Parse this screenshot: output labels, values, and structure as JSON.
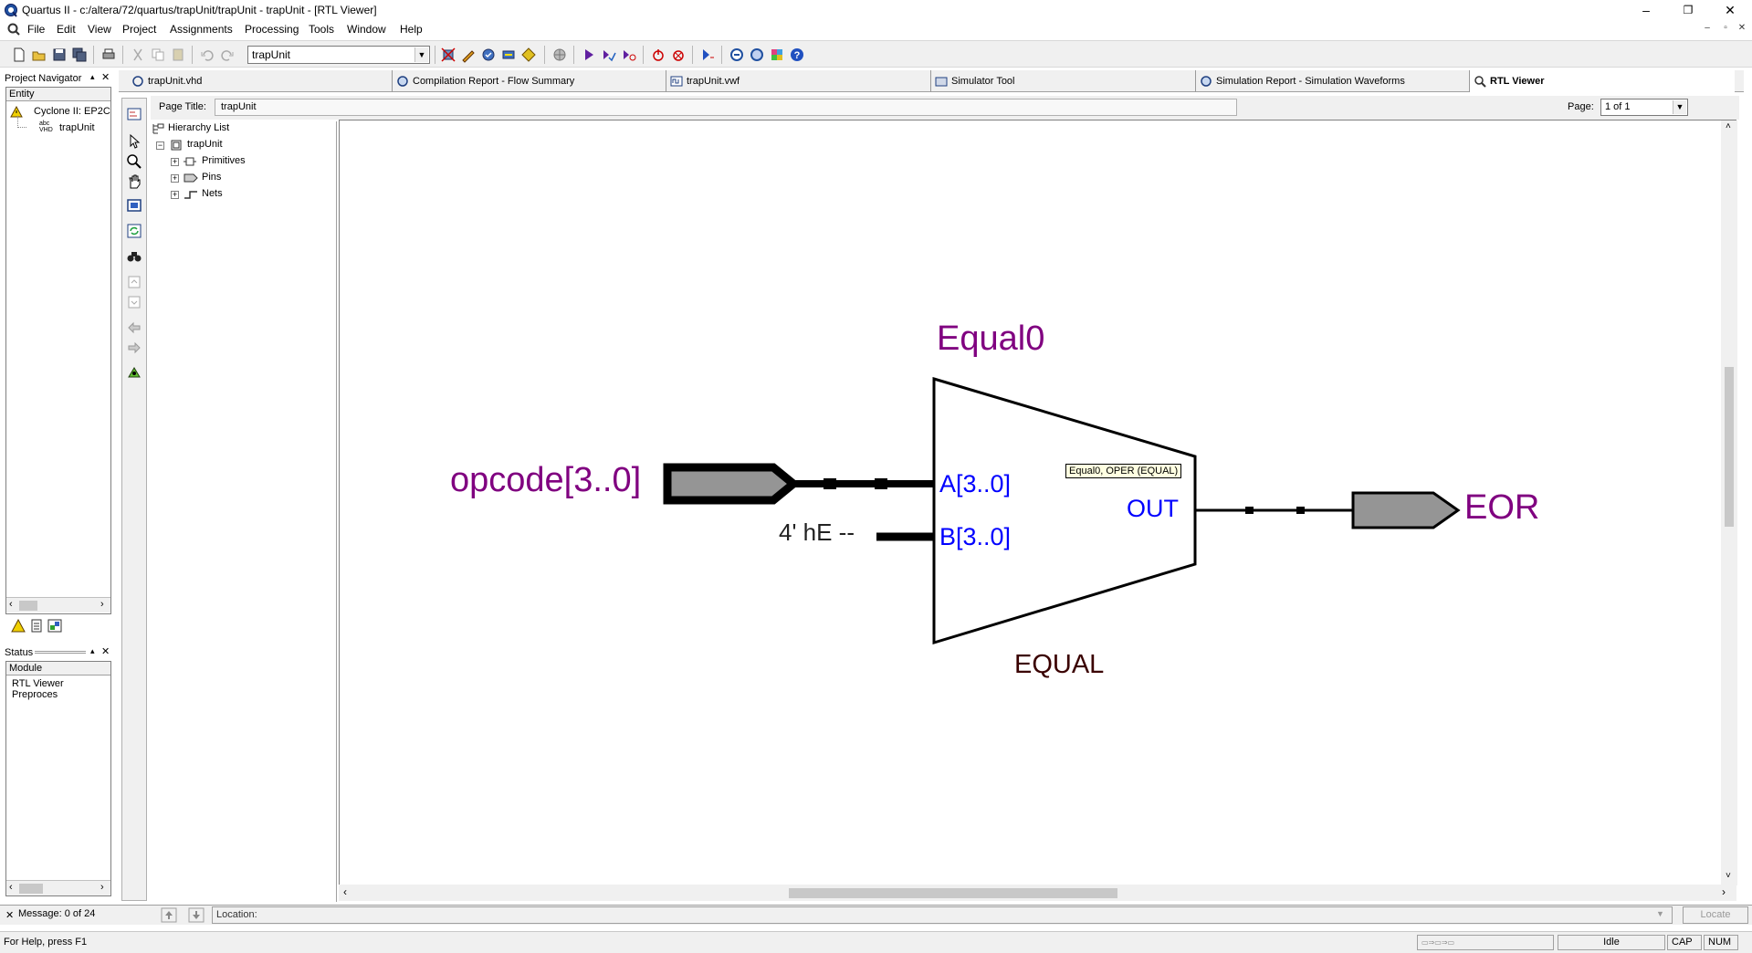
{
  "window": {
    "title": "Quartus II - c:/altera/72/quartus/trapUnit/trapUnit - trapUnit - [RTL Viewer]",
    "minimize": "–",
    "restore": "❐",
    "close": "✕"
  },
  "menu": [
    "File",
    "Edit",
    "View",
    "Project",
    "Assignments",
    "Processing",
    "Tools",
    "Window",
    "Help"
  ],
  "toolbar": {
    "entity_value": "trapUnit"
  },
  "tabs": [
    "trapUnit.vhd",
    "Compilation Report - Flow Summary",
    "trapUnit.vwf",
    "Simulator Tool",
    "Simulation Report - Simulation Waveforms",
    "RTL Viewer"
  ],
  "project_navigator": {
    "title": "Project Navigator",
    "column": "Entity",
    "items": [
      "Cyclone II: EP2C",
      "trapUnit"
    ]
  },
  "status_panel": {
    "title": "Status",
    "column": "Module",
    "items": [
      "RTL Viewer Preproces"
    ]
  },
  "viewer": {
    "page_title_label": "Page Title:",
    "page_title_value": "trapUnit",
    "page_label": "Page:",
    "page_value": "1 of 1"
  },
  "hierarchy": {
    "root_label": "Hierarchy List",
    "top": "trapUnit",
    "children": [
      "Primitives",
      "Pins",
      "Nets"
    ]
  },
  "schematic": {
    "instance_name": "Equal0",
    "operator": "EQUAL",
    "input_pin": "opcode[3..0]",
    "constant": "4' hE --",
    "port_a": "A[3..0]",
    "port_b": "B[3..0]",
    "port_out": "OUT",
    "output_pin": "EOR",
    "tooltip": "Equal0, OPER (EQUAL)"
  },
  "message_bar": {
    "message": "Message: 0 of 24",
    "location_label": "Location:",
    "locate_button": "Locate"
  },
  "status_bar": {
    "help": "For Help, press F1",
    "state": "Idle",
    "cap": "CAP",
    "num": "NUM"
  },
  "colors": {
    "instance_purple": "#800080",
    "port_blue": "#0000ff",
    "operator_brown": "#3a0000",
    "pin_fill": "#959595"
  }
}
